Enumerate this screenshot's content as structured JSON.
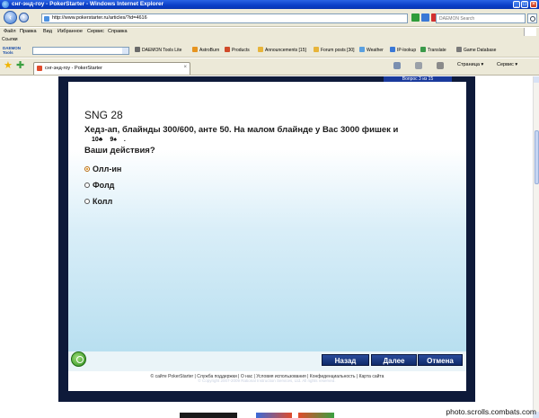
{
  "window": {
    "title": "снг-энд-гоу - PokerStarter - Windows Internet Explorer"
  },
  "address": {
    "url": "http://www.pokerstarter.ru/articles/?id=4616",
    "search_placeholder": "DAEMON Search"
  },
  "menu": [
    "Файл",
    "Правка",
    "Вид",
    "Избранное",
    "Сервис",
    "Справка"
  ],
  "links_label": "Ссылки",
  "toolbar": {
    "logo": "DAEMON Tools",
    "items": [
      "DAEMON Tools Lite",
      "AstroBurn",
      "Products",
      "Announcements [15]",
      "Forum posts [30]",
      "Weather",
      "IP-lookup",
      "Translate",
      "Game Database"
    ]
  },
  "tab": {
    "label": "снг-энд-гоу - PokerStarter"
  },
  "right_tools": {
    "page": "Страница",
    "service": "Сервис"
  },
  "quiz": {
    "counter": "Вопрос 3 из 15",
    "title": "SNG 28",
    "question": "Хедз-ап, блайнды 300/600, анте 50. На малом блайнде у Вас 3000 фишек и",
    "cards": [
      "10♣",
      "9♠",
      "."
    ],
    "question2": "Ваши действия?",
    "options": [
      {
        "label": "Олл-ин",
        "selected": true
      },
      {
        "label": "Фолд",
        "selected": false
      },
      {
        "label": "Колл",
        "selected": false
      }
    ],
    "buttons": {
      "back": "Назад",
      "next": "Далее",
      "cancel": "Отмена"
    }
  },
  "footer": {
    "links": "© сайте PokerStarter | Служба поддержки | О нас | Условия использования | Конфиденциальность | Карта сайта",
    "copyright": "© Copyright 2007-2009 Rational Instruction Services, Ltd. All rights reserved."
  },
  "watermark": "photo.scrolls.combats.com"
}
